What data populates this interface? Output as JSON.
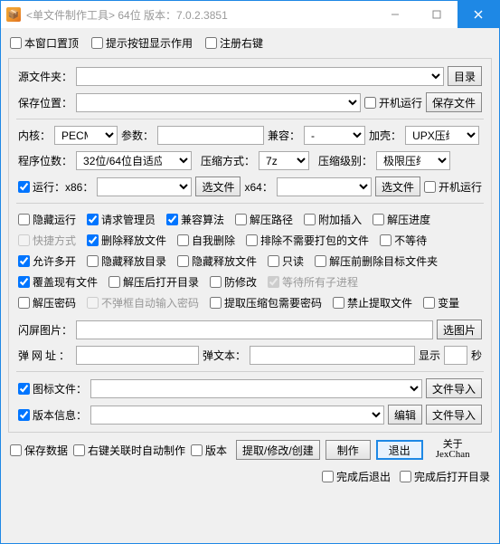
{
  "window": {
    "title": "<单文件制作工具> 64位 版本：7.0.2.3851"
  },
  "topChecks": {
    "alwaysTop": "本窗口置顶",
    "hintBtn": "提示按钮显示作用",
    "regRight": "注册右键"
  },
  "src": {
    "label": "源文件夹：",
    "btn": "目录"
  },
  "save": {
    "label": "保存位置：",
    "bootRun": "开机运行",
    "btn": "保存文件"
  },
  "core": {
    "label": "内核：",
    "value": "PECMD",
    "paramLabel": "参数：",
    "compatLabel": "兼容：",
    "compatValue": "-",
    "shellLabel": "加壳：",
    "shellValue": "UPX压缩"
  },
  "bits": {
    "label": "程序位数：",
    "value": "32位/64位自适应",
    "compLabel": "压缩方式：",
    "compValue": "7z",
    "levelLabel": "压缩级别：",
    "levelValue": "极限压缩"
  },
  "run": {
    "x86Label": "运行：x86：",
    "x86Btn": "选文件",
    "x64Label": "x64：",
    "x64Btn": "选文件",
    "bootRun": "开机运行"
  },
  "opts": {
    "hideRun": "隐藏运行",
    "reqAdmin": "请求管理员",
    "compatAlg": "兼容算法",
    "extractPath": "解压路径",
    "plugin": "附加插入",
    "progress": "解压进度",
    "shortcut": "快捷方式",
    "delExtract": "删除释放文件",
    "selfDel": "自我删除",
    "excludePack": "排除不需要打包的文件",
    "noWait": "不等待",
    "allowMulti": "允许多开",
    "hideDir": "隐藏释放目录",
    "hideFiles": "隐藏释放文件",
    "readonly": "只读",
    "delBeforeExtract": "解压前删除目标文件夹",
    "overwrite": "覆盖现有文件",
    "openAfter": "解压后打开目录",
    "antiMod": "防修改",
    "waitChild": "等待所有子进程",
    "extractPwd": "解压密码",
    "noPwdDlg": "不弹框自动输入密码",
    "needPwd": "提取压缩包需要密码",
    "noExtract": "禁止提取文件",
    "var": "变量"
  },
  "flash": {
    "label": "闪屏图片：",
    "btn": "选图片"
  },
  "popup": {
    "urlLabel": "弹网址：",
    "textLabel": "弹文本：",
    "showLabel": "显示",
    "unit": "秒"
  },
  "icon": {
    "label": "图标文件：",
    "btn": "文件导入"
  },
  "ver": {
    "label": "版本信息：",
    "editBtn": "编辑",
    "importBtn": "文件导入"
  },
  "bottom": {
    "saveData": "保存数据",
    "autoMake": "右键关联时自动制作",
    "version": "版本",
    "extract": "提取/修改/创建",
    "make": "制作",
    "exit": "退出",
    "about1": "关于",
    "about2": "JexChan"
  },
  "bottom2": {
    "exitAfter": "完成后退出",
    "openAfter": "完成后打开目录"
  }
}
